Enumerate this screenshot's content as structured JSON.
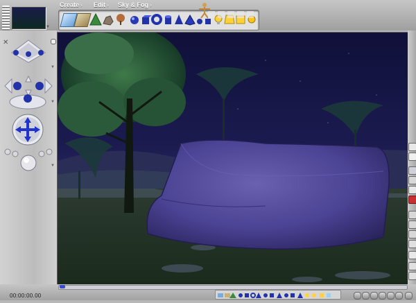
{
  "menu": {
    "create_label": "Create",
    "edit_label": "Edit",
    "sky_fog_label": "Sky & Fog"
  },
  "palette": {
    "groups": [
      "terrain-tools",
      "plant-tools",
      "primitive-tools",
      "figure-tools",
      "light-tools"
    ],
    "icons": [
      "water-plane-icon",
      "terrain-icon",
      "plant-icon",
      "rock-icon",
      "tree-icon",
      "sphere-icon",
      "cube-icon",
      "torus-icon",
      "cylinder-icon",
      "cone-icon",
      "pyramid-icon",
      "sphere-small-icon",
      "cube-small-icon",
      "figure-icon",
      "light-bulb-icon",
      "light-spot-icon",
      "light-area-icon",
      "light-sun-icon"
    ]
  },
  "left_panel": {
    "camera_controls": [
      "camera-pan-control",
      "camera-rotate-control",
      "camera-trackball-control",
      "camera-move-control",
      "camera-zoom-control"
    ]
  },
  "timeline": {
    "time": "00:00:00.00"
  },
  "colors": {
    "accent": "#2233aa",
    "ui_gray": "#b7b7b7",
    "sky": "#1d1d55",
    "rock": "#4a4290"
  }
}
